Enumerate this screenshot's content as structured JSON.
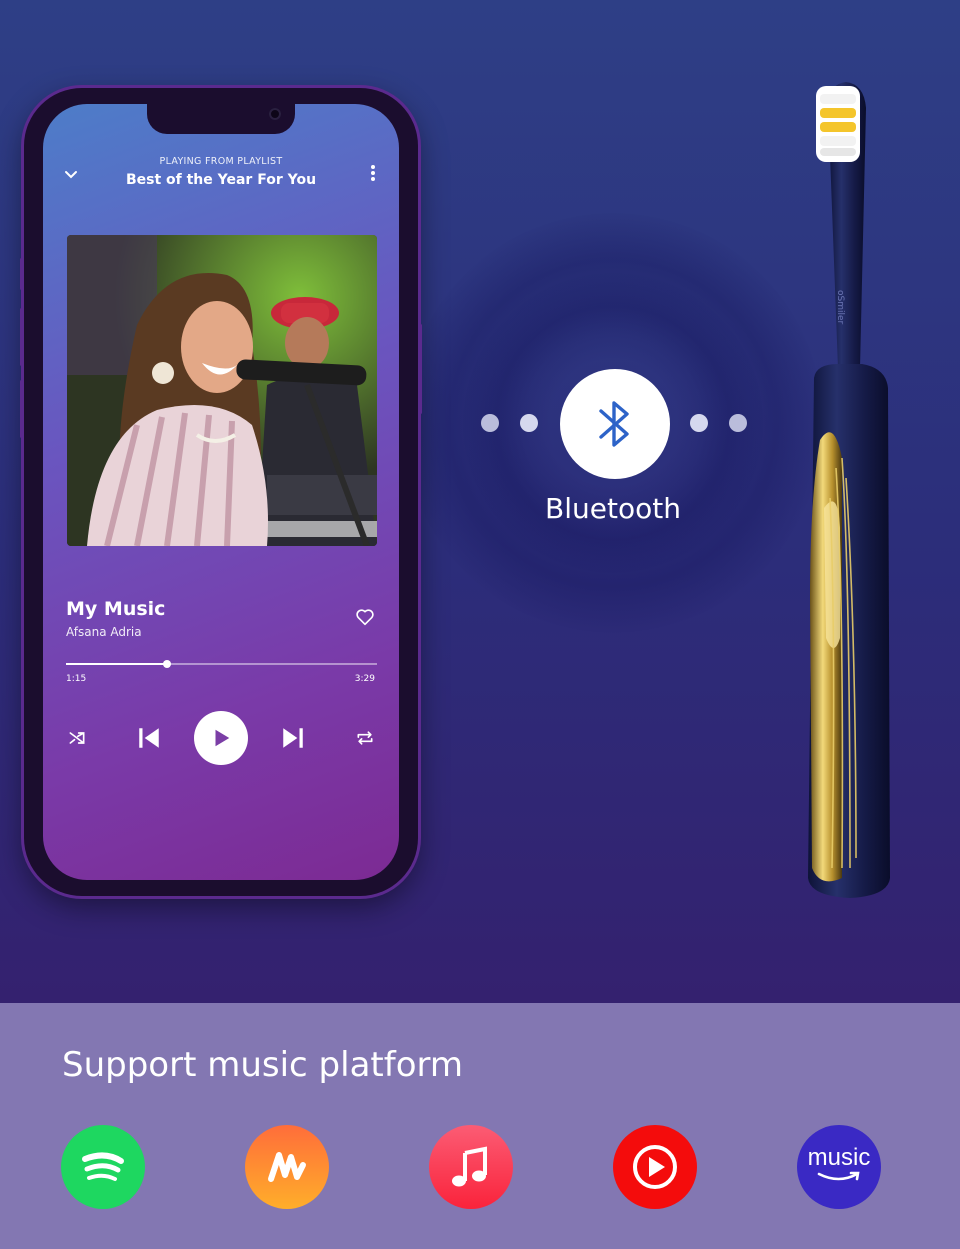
{
  "player": {
    "playing_from_label": "PLAYING FROM PLAYLIST",
    "playlist_title": "Best of the Year For You",
    "song_title": "My Music",
    "artist": "Afsana Adria",
    "current_time": "1:15",
    "total_time": "3:29",
    "progress_fraction": 0.325
  },
  "connection": {
    "label": "Bluetooth",
    "icon": "bluetooth-icon"
  },
  "toothbrush": {
    "brand_text": "oSmiler"
  },
  "platforms": {
    "title": "Support music platform",
    "items": [
      {
        "name": "spotify",
        "icon": "spotify-icon",
        "color": "#1ed760"
      },
      {
        "name": "audiomack",
        "icon": "audiomack-icon",
        "color": "#ff8a1e"
      },
      {
        "name": "apple-music",
        "icon": "apple-music-icon",
        "color": "#fa3a4e"
      },
      {
        "name": "youtube-music",
        "icon": "youtube-music-icon",
        "color": "#f40c0c"
      },
      {
        "name": "amazon-music",
        "icon": "amazon-music-icon",
        "color": "#3a29c4",
        "text": "music"
      }
    ]
  },
  "colors": {
    "accent_purple": "#7a3aa8",
    "band": "#8377b2",
    "gold": "#d9b64a"
  }
}
